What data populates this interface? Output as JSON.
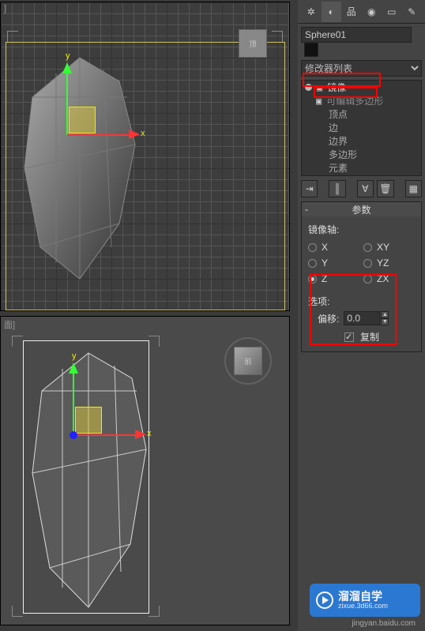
{
  "viewport_top": {
    "label": "]"
  },
  "viewport_bottom": {
    "label": "面]"
  },
  "axis": {
    "x": "x",
    "y": "y"
  },
  "viewcube": {
    "face_top": "顶",
    "face_front": "前"
  },
  "object_name": "Sphere01",
  "modifier_dropdown": "修改器列表",
  "stack": {
    "mirror": "镜像",
    "editable_poly": "可编辑多边形",
    "sub": {
      "vertex": "顶点",
      "edge": "边",
      "border": "边界",
      "polygon": "多边形",
      "element": "元素"
    }
  },
  "rollout": {
    "title": "参数",
    "axis_label": "镜像轴:",
    "axes": {
      "x": "X",
      "y": "Y",
      "z": "Z",
      "xy": "XY",
      "yz": "YZ",
      "zx": "ZX"
    },
    "options_label": "选项:",
    "offset_label": "偏移:",
    "offset_value": "0.0",
    "copy_label": "复制"
  },
  "watermark": {
    "brand": "溜溜自学",
    "sub": "zixue.3d66.com",
    "url": "jingyan.baidu.com"
  }
}
